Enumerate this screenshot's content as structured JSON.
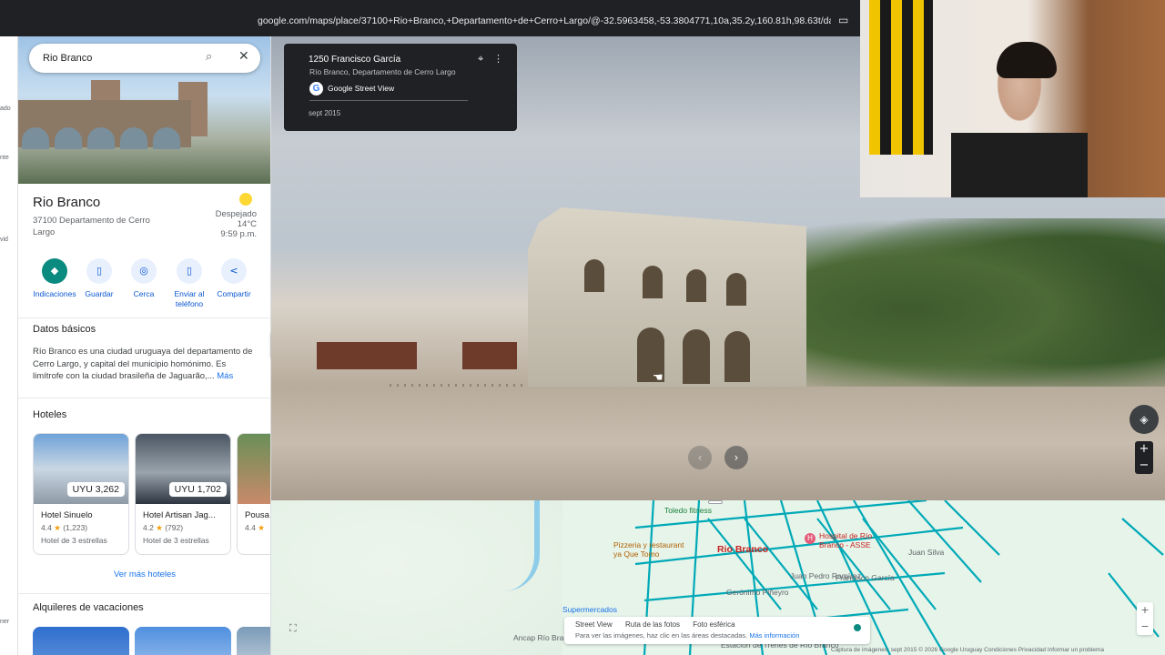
{
  "browser": {
    "url": "google.com/maps/place/37100+Rio+Branco,+Departamento+de+Cerro+Largo/@-32.5963458,-53.3804771,10a,35.2y,160.81h,98.63t/data=!3m7!1e...",
    "site_info_icon": "tune-icon",
    "bookmark_icon": "bookmark-icon"
  },
  "strip": {
    "labels": [
      "ado",
      "nte",
      "vid",
      "ner"
    ]
  },
  "search": {
    "query": "Rio Branco"
  },
  "place": {
    "title": "Rio Branco",
    "address": "37100 Departamento de Cerro Largo",
    "weather_status": "Despejado",
    "temperature": "14°C",
    "time": "9:59 p.m."
  },
  "actions": [
    {
      "label": "Indicaciones",
      "icon": "directions-icon"
    },
    {
      "label": "Guardar",
      "icon": "bookmark-icon"
    },
    {
      "label": "Cerca",
      "icon": "nearby-icon"
    },
    {
      "label": "Enviar al teléfono",
      "icon": "phone-icon"
    },
    {
      "label": "Compartir",
      "icon": "share-icon"
    }
  ],
  "basics": {
    "heading": "Datos básicos",
    "text": "Río Branco es una ciudad uruguaya del departamento de Cerro Largo, y capital del municipio homónimo. Es limítrofe con la ciudad brasileña de Jaguarão,...",
    "more": "Más"
  },
  "hotels": {
    "heading": "Hoteles",
    "items": [
      {
        "name": "Hotel Sinuelo",
        "price": "UYU 3,262",
        "rating": "4.4",
        "reviews": "(1,223)",
        "class": "Hotel de 3 estrellas"
      },
      {
        "name": "Hotel Artisan Jag...",
        "price": "UYU 1,702",
        "rating": "4.2",
        "reviews": "(792)",
        "class": "Hotel de 3 estrellas"
      },
      {
        "name": "Pousa",
        "price": "",
        "rating": "4.4",
        "reviews": "",
        "class": ""
      }
    ],
    "more": "Ver más hoteles"
  },
  "rentals": {
    "heading": "Alquileres de vacaciones"
  },
  "streetview": {
    "address": "1250 Francisco García",
    "locality": "Río Branco, Departamento de Cerro Largo",
    "provider": "Google Street View",
    "date": "sept 2015"
  },
  "map": {
    "place_label": "Rio Branco",
    "labels": [
      {
        "text": "Toledo fitness",
        "color": "#188038"
      },
      {
        "text": "Pizzeria y restaurant ya Que Tomo",
        "color": "#b06000"
      },
      {
        "text": "Hospital de Río Branco - ASSE",
        "color": "#c5221f"
      },
      {
        "text": "Supermercados",
        "color": "#1a73e8"
      },
      {
        "text": "Ancap Río Branco",
        "color": "#5f6368"
      },
      {
        "text": "Juan Silva",
        "color": "#5f6368"
      },
      {
        "text": "Juan Pedro Ramírez",
        "color": "#5f6368"
      },
      {
        "text": "Francisco García",
        "color": "#5f6368"
      },
      {
        "text": "Gerónimo Piñeyro",
        "color": "#5f6368"
      },
      {
        "text": "Estación de Trenes de Río Branco",
        "color": "#5f6368"
      }
    ],
    "legend": {
      "items": [
        "Street View",
        "Ruta de las fotos",
        "Foto esférica"
      ],
      "hint": "Para ver las imágenes, haz clic en las áreas destacadas.",
      "link": "Más información"
    },
    "footer": "Captura de imágenes: sept 2015   © 2026 Google   Uruguay   Condiciones   Privacidad   Informar un problema"
  },
  "colors": {
    "accent": "#0b8a7f",
    "link": "#1a73e8",
    "streetview_lines": "#00a9b7"
  }
}
